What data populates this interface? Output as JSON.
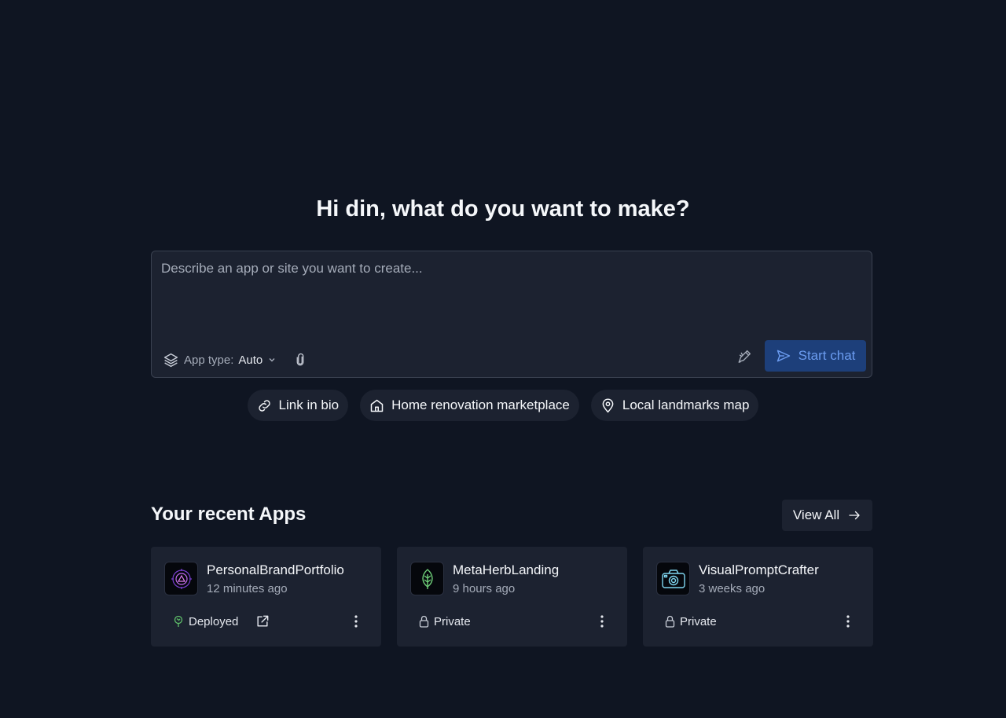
{
  "greeting": "Hi din, what do you want to make?",
  "composer": {
    "placeholder": "Describe an app or site you want to create...",
    "value": "",
    "app_type_label": "App type:",
    "app_type_value": "Auto",
    "start_label": "Start chat"
  },
  "suggestions": [
    {
      "label": "Link in bio",
      "icon": "link-icon"
    },
    {
      "label": "Home renovation marketplace",
      "icon": "home-icon"
    },
    {
      "label": "Local landmarks map",
      "icon": "map-pin-icon"
    }
  ],
  "recent": {
    "title": "Your recent Apps",
    "view_all": "View All",
    "apps": [
      {
        "name": "PersonalBrandPortfolio",
        "time": "12 minutes ago",
        "status": "Deployed",
        "icon": "portfolio-logo",
        "status_icon": "deployed-icon"
      },
      {
        "name": "MetaHerbLanding",
        "time": "9 hours ago",
        "status": "Private",
        "icon": "leaf-logo",
        "status_icon": "lock-icon"
      },
      {
        "name": "VisualPromptCrafter",
        "time": "3 weeks ago",
        "status": "Private",
        "icon": "camera-logo",
        "status_icon": "lock-icon"
      }
    ]
  },
  "colors": {
    "background": "#0f1522",
    "surface": "#1c2230",
    "accent": "#6b9cf0",
    "accent_bg": "#1d3f7a",
    "deployed": "#5fbf6a"
  }
}
